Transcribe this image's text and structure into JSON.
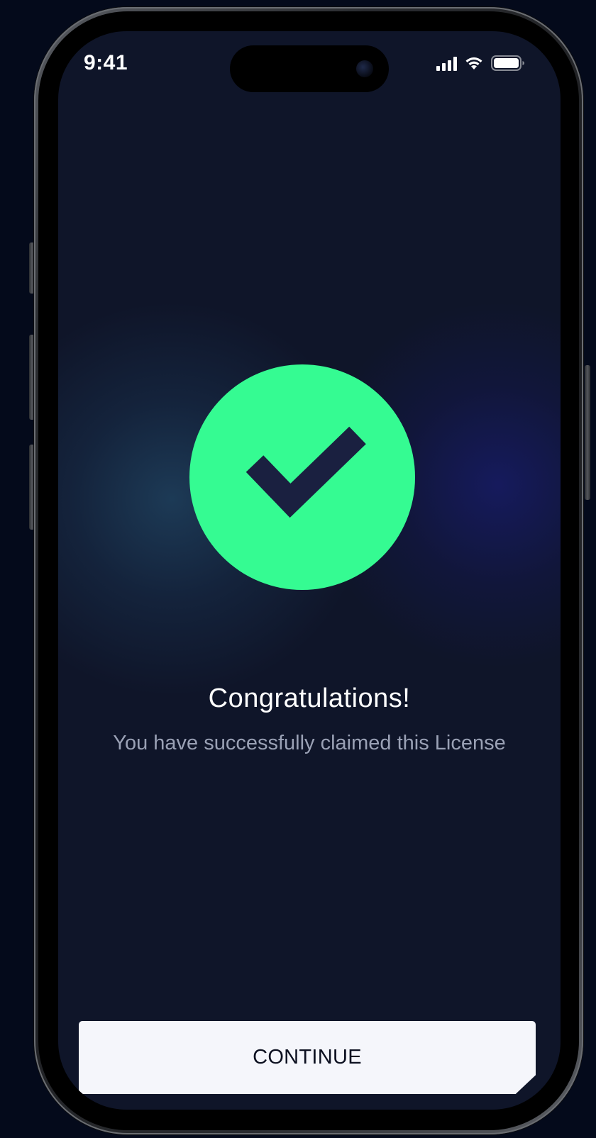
{
  "status_bar": {
    "time": "9:41",
    "icons": [
      "signal-icon",
      "wifi-icon",
      "battery-icon"
    ]
  },
  "success": {
    "icon": "checkmark-icon",
    "title": "Congratulations!",
    "message": "You have successfully claimed this License"
  },
  "actions": {
    "continue_label": "CONTINUE"
  },
  "colors": {
    "background": "#0f1529",
    "accent_green": "#35fb92",
    "checkmark": "#1a2040",
    "button_bg": "#f5f6fb",
    "button_text": "#0c1020",
    "subtitle_text": "#9aa1b5"
  }
}
